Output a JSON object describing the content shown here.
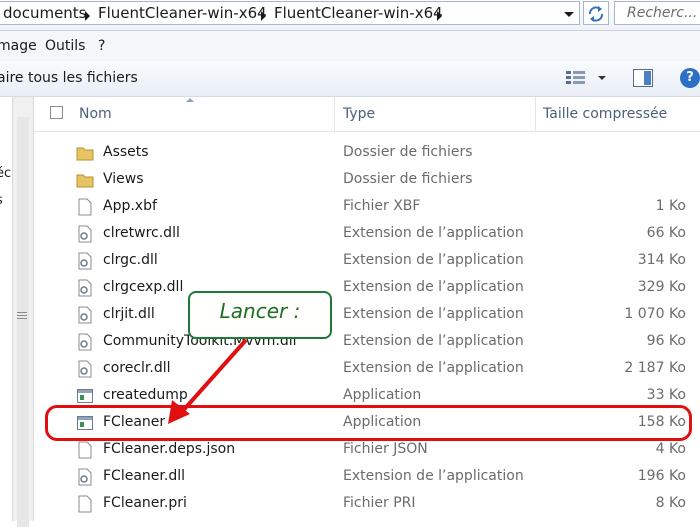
{
  "address_bar": {
    "crumbs": [
      "documents",
      "FluentCleaner-win-x64",
      "FluentCleaner-win-x64"
    ],
    "search_placeholder": "Recherc..."
  },
  "menu": {
    "items": [
      "mage",
      "Outils",
      "?"
    ]
  },
  "toolbar": {
    "extract_all": "aire tous les fichiers"
  },
  "nav_pane": {
    "fragments": [
      "éc",
      "s"
    ]
  },
  "columns": {
    "name": "Nom",
    "type": "Type",
    "size": "Taille compressée"
  },
  "files": [
    {
      "name": "Assets",
      "type": "Dossier de fichiers",
      "size": "",
      "icon": "folder-icon"
    },
    {
      "name": "Views",
      "type": "Dossier de fichiers",
      "size": "",
      "icon": "folder-icon"
    },
    {
      "name": "App.xbf",
      "type": "Fichier XBF",
      "size": "1 Ko",
      "icon": "file-icon"
    },
    {
      "name": "clretwrc.dll",
      "type": "Extension de l’application",
      "size": "66 Ko",
      "icon": "dll-icon"
    },
    {
      "name": "clrgc.dll",
      "type": "Extension de l’application",
      "size": "314 Ko",
      "icon": "dll-icon"
    },
    {
      "name": "clrgcexp.dll",
      "type": "Extension de l’application",
      "size": "329 Ko",
      "icon": "dll-icon"
    },
    {
      "name": "clrjit.dll",
      "type": "Extension de l’application",
      "size": "1 070 Ko",
      "icon": "dll-icon"
    },
    {
      "name": "CommunityToolkit.Mvvm.dll",
      "type": "Extension de l’application",
      "size": "96 Ko",
      "icon": "dll-icon"
    },
    {
      "name": "coreclr.dll",
      "type": "Extension de l’application",
      "size": "2 187 Ko",
      "icon": "dll-icon"
    },
    {
      "name": "createdump",
      "type": "Application",
      "size": "33 Ko",
      "icon": "app-icon"
    },
    {
      "name": "FCleaner",
      "type": "Application",
      "size": "158 Ko",
      "icon": "app-icon"
    },
    {
      "name": "FCleaner.deps.json",
      "type": "Fichier JSON",
      "size": "4 Ko",
      "icon": "file-icon"
    },
    {
      "name": "FCleaner.dll",
      "type": "Extension de l’application",
      "size": "196 Ko",
      "icon": "dll-icon"
    },
    {
      "name": "FCleaner.pri",
      "type": "Fichier PRI",
      "size": "8 Ko",
      "icon": "file-icon"
    }
  ],
  "annotation": {
    "callout_text": "Lancer :",
    "callout_color": "#1f7a3a",
    "highlight_color": "#e01010",
    "highlighted_file": "FCleaner"
  }
}
